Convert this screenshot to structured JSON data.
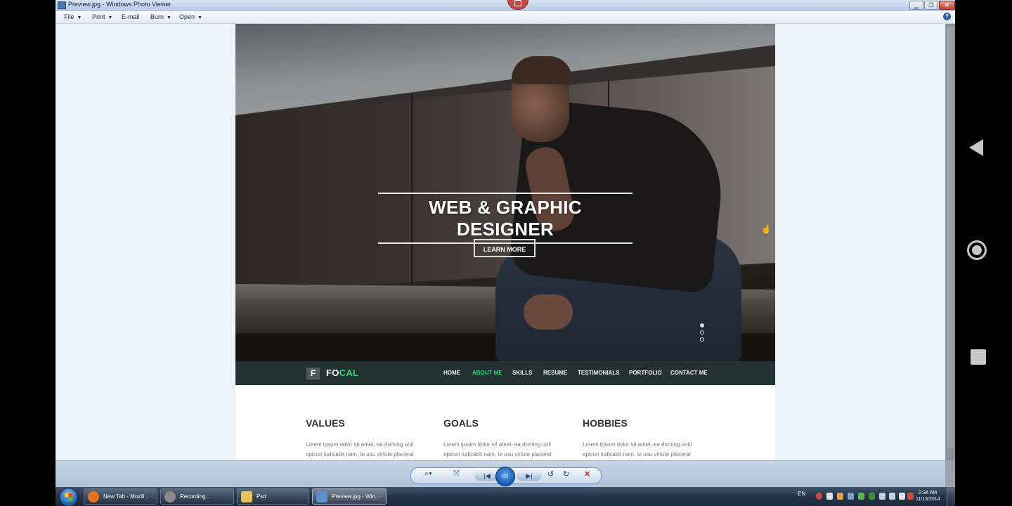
{
  "window": {
    "title": "Preview.jpg - Windows Photo Viewer"
  },
  "menu": {
    "items": [
      "File",
      "Print",
      "E-mail",
      "Burn",
      "Open"
    ],
    "help_label": "?"
  },
  "preview": {
    "hero_title": "WEB & GRAPHIC DESIGNER",
    "hero_button": "LEARN MORE",
    "logo_letter": "F",
    "logo_text_white": "FO",
    "logo_text_accent": "CAL",
    "nav": [
      "HOME",
      "ABOUT ME",
      "SKILLS",
      "RESUME",
      "TESTIMONIALS",
      "PORTFOLIO",
      "CONTACT ME"
    ],
    "active_nav": "ABOUT ME",
    "columns": [
      {
        "title": "VALUES",
        "line1": "Lorem ipsum dolor sit amet, ea doming unil",
        "line2": "epicuri iudicabit nam, te usu virtute placerat"
      },
      {
        "title": "GOALS",
        "line1": "Lorem ipsum dolor sit amet, ea doming unil",
        "line2": "epicuri iudicabit nam, te usu virtute placerat"
      },
      {
        "title": "HOBBIES",
        "line1": "Lorem ipsum dolor sit amet, ea doming until",
        "line2": "epicuri iudicabit nam, te usu virtute placerat"
      }
    ],
    "accent_color": "#35d07a"
  },
  "controls": {
    "zoom_icon": "magnifier-icon",
    "fit_icon": "actual-size-icon",
    "prev_label": "|◀",
    "play_label": "▭",
    "next_label": "▶|",
    "rotate_left": "↺",
    "rotate_right": "↻",
    "delete": "✕"
  },
  "taskbar": {
    "items": [
      {
        "label": "New Tab - Mozill...",
        "icon": "firefox-icon",
        "color": "#e8731f"
      },
      {
        "label": "Recording...",
        "icon": "recorder-icon",
        "color": "#8a8a8a"
      },
      {
        "label": "Psd",
        "icon": "folder-icon",
        "color": "#e8c25a"
      },
      {
        "label": "Preview.jpg - Win...",
        "icon": "photo-viewer-icon",
        "color": "#5b8fcf"
      }
    ],
    "language": "EN",
    "time": "2:34 AM",
    "date": "11/13/2014"
  }
}
